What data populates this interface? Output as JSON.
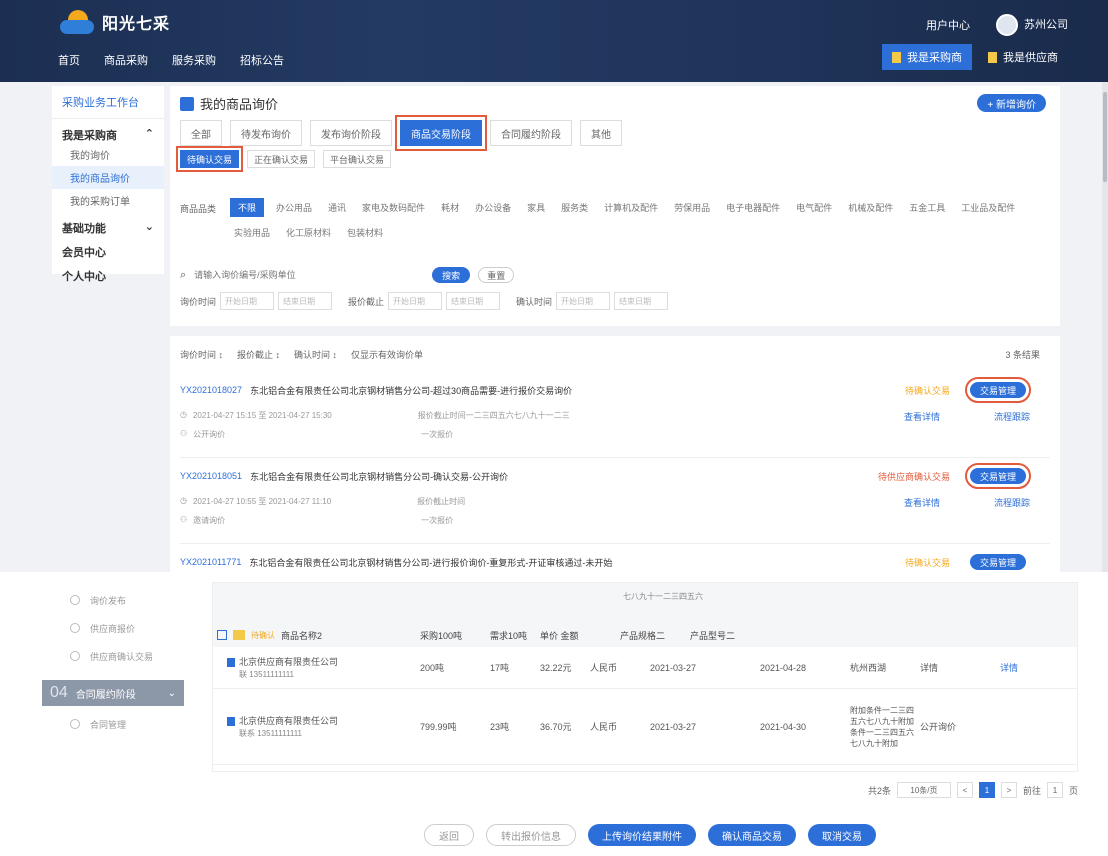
{
  "header": {
    "logo_text": "阳光七采",
    "nav": [
      "首页",
      "商品采购",
      "服务采购",
      "招标公告"
    ],
    "user_center": "用户中心",
    "user_name": "苏州公司",
    "quick": [
      "我是采购商",
      "我是供应商"
    ]
  },
  "sidebar": {
    "title": "采购业务工作台",
    "group1": "我是采购商",
    "items": [
      "我的询价",
      "我的商品询价",
      "我的采购订单"
    ],
    "group2": "基础功能",
    "group3": "会员中心",
    "group4": "个人中心"
  },
  "main": {
    "title": "我的商品询价",
    "add_label": "+ 新增询价",
    "stage_tabs": [
      "全部",
      "待发布询价",
      "发布询价阶段",
      "商品交易阶段",
      "合同履约阶段",
      "其他"
    ],
    "sub_tabs": [
      "待确认交易",
      "正在确认交易",
      "平台确认交易"
    ],
    "cat_label": "商品品类",
    "categories": [
      "不限",
      "办公用品",
      "通讯",
      "家电及数码配件",
      "耗材",
      "办公设备",
      "家具",
      "服务类",
      "计算机及配件",
      "劳保用品",
      "电子电器配件",
      "电气配件",
      "机械及配件",
      "五金工具",
      "工业品及配件",
      "实验用品",
      "化工原材料",
      "包装材料"
    ],
    "search_placeholder": "请输入询价编号/采购单位",
    "search_btn": "搜索",
    "reset_btn": "重置",
    "ranges": [
      {
        "label": "询价时间",
        "from": "开始日期",
        "to": "结束日期"
      },
      {
        "label": "报价截止",
        "from": "开始日期",
        "to": "结束日期"
      },
      {
        "label": "确认时间",
        "from": "开始日期",
        "to": "结束日期"
      }
    ],
    "sort": [
      "询价时间 ↕",
      "报价截止 ↕",
      "确认时间 ↕",
      "仅显示有效询价单"
    ],
    "result_count": "3 条结果",
    "records": [
      {
        "no": "YX2021018027",
        "title": "东北铝合金有限责任公司北京钢材销售分公司-超过30商品需要-进行报价交易询价",
        "status": "待确认交易",
        "btn": "交易管理",
        "meta1": "2021-04-27 15:15 至 2021-04-27 15:30",
        "meta2": "报价截止时间一二三四五六七八九十一二三",
        "meta3": "公开询价",
        "meta4": "一次报价",
        "link1": "查看详情",
        "link2": "流程跟踪"
      },
      {
        "no": "YX2021018051",
        "title": "东北铝合金有限责任公司北京钢材销售分公司-确认交易-公开询价",
        "status": "待供应商确认交易",
        "btn": "交易管理",
        "meta1": "2021-04-27 10:55 至 2021-04-27 11:10",
        "meta2": "报价截止时间",
        "meta3": "邀请询价",
        "meta4": "一次报价",
        "link1": "查看详情",
        "link2": "流程跟踪"
      },
      {
        "no": "YX2021011771",
        "title": "东北铝合金有限责任公司北京钢材销售分公司-进行报价询价-重复形式-开证审核通过-未开始",
        "status": "待确认交易",
        "btn": "交易管理"
      }
    ]
  },
  "bottom": {
    "steps_top": [
      "询价发布",
      "供应商报价",
      "供应商确认交易"
    ],
    "current_num": "04",
    "current_label": "合同履约阶段",
    "steps_after": [
      "合同管理"
    ],
    "top_text": "七八九十一二三四五六",
    "group": {
      "tag": "待确认",
      "name": "商品名称2",
      "c1": "采购100吨",
      "c2": "需求10吨",
      "c3": "单价 金额",
      "c4": "产品规格二",
      "c5": "产品型号二"
    },
    "rows": [
      {
        "supplier": "北京供应商有限责任公司",
        "phone": "联 13511111111",
        "c1": "200吨",
        "c2": "17吨",
        "c3": "32.22元",
        "c4": "人民币",
        "c5": "2021-03-27",
        "c6": "2021-04-28",
        "c7": "杭州西湖",
        "c8": "详情",
        "c9": "详情"
      },
      {
        "supplier": "北京供应商有限责任公司",
        "phone": "联系 13511111111",
        "c1": "799.99吨",
        "c2": "23吨",
        "c3": "36.70元",
        "c4": "人民币",
        "c5": "2021-03-27",
        "c6": "2021-04-30",
        "c7": "附加条件一二三四五六七八九十附加条件一二三四五六七八九十附加",
        "c8": "公开询价",
        "c9": ""
      }
    ],
    "pager": {
      "total": "共2条",
      "size": "10条/页",
      "prev": "<",
      "current": "1",
      "next": ">",
      "goto": "前往",
      "page": "1",
      "unit": "页"
    },
    "actions": [
      "返回",
      "转出报价信息",
      "上传询价结果附件",
      "确认商品交易",
      "取消交易"
    ]
  }
}
